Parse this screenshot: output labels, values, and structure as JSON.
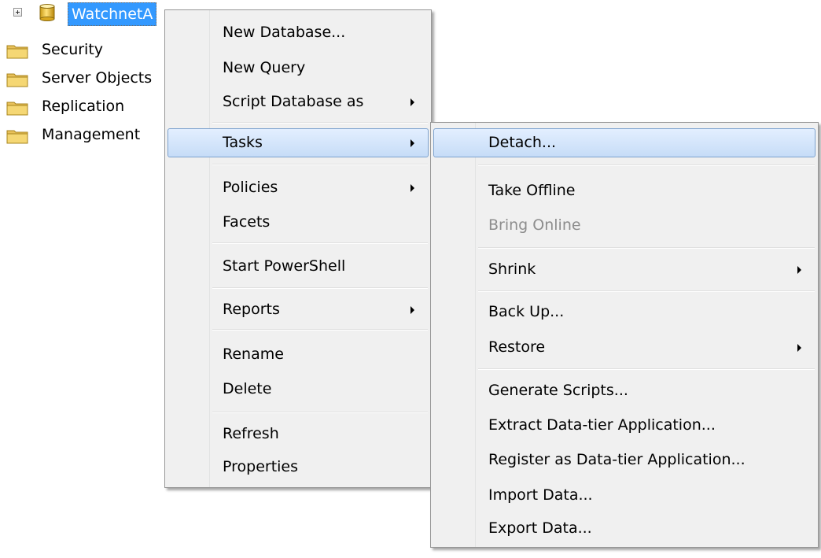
{
  "tree": {
    "database_label": "WatchnetA",
    "folders": [
      "Security",
      "Server Objects",
      "Replication",
      "Management"
    ]
  },
  "context_menu": {
    "items": [
      {
        "label": "New Database...",
        "submenu": false
      },
      {
        "label": "New Query",
        "submenu": false
      },
      {
        "label": "Script Database as",
        "submenu": true
      },
      {
        "label": "Tasks",
        "submenu": true,
        "highlighted": true
      },
      {
        "label": "Policies",
        "submenu": true
      },
      {
        "label": "Facets",
        "submenu": false
      },
      {
        "label": "Start PowerShell",
        "submenu": false
      },
      {
        "label": "Reports",
        "submenu": true
      },
      {
        "label": "Rename",
        "submenu": false
      },
      {
        "label": "Delete",
        "submenu": false
      },
      {
        "label": "Refresh",
        "submenu": false
      },
      {
        "label": "Properties",
        "submenu": false
      }
    ]
  },
  "tasks_submenu": {
    "items": [
      {
        "label": "Detach...",
        "highlighted": true
      },
      {
        "label": "Take Offline"
      },
      {
        "label": "Bring Online",
        "disabled": true
      },
      {
        "label": "Shrink",
        "submenu": true
      },
      {
        "label": "Back Up..."
      },
      {
        "label": "Restore",
        "submenu": true
      },
      {
        "label": "Generate Scripts..."
      },
      {
        "label": "Extract Data-tier Application..."
      },
      {
        "label": "Register as Data-tier Application..."
      },
      {
        "label": "Import Data..."
      },
      {
        "label": "Export Data..."
      }
    ]
  },
  "colors": {
    "selection": "#3399ff",
    "menu_background": "#f0f0f0",
    "menu_highlight_border": "#7da2ce",
    "disabled_text": "#8d8d8d",
    "folder": "#e8c15a"
  }
}
